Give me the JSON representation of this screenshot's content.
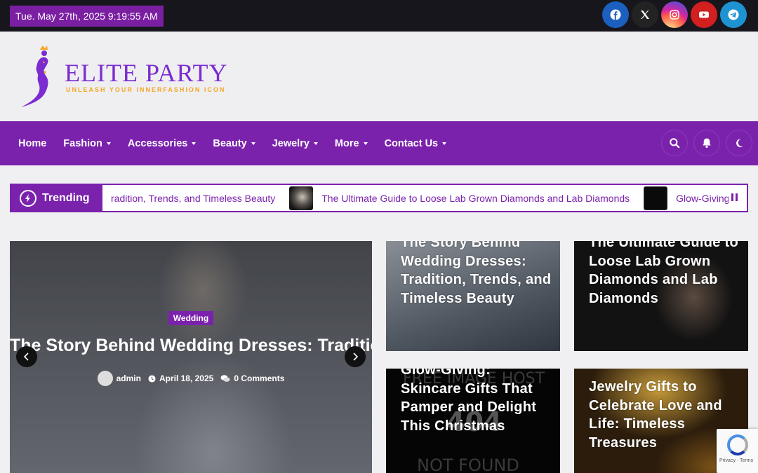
{
  "topbar": {
    "date": "Tue. May 27th, 2025 9:19:55 AM",
    "socials": [
      {
        "name": "facebook-icon",
        "color": "#1b5fbf"
      },
      {
        "name": "x-icon",
        "color": "#232323"
      },
      {
        "name": "instagram-icon",
        "color": "#c13584"
      },
      {
        "name": "youtube-icon",
        "color": "#d21f1f"
      },
      {
        "name": "telegram-icon",
        "color": "#1d93d2"
      }
    ]
  },
  "logo": {
    "title": "ELITE PARTY",
    "tagline": "UNLEASH YOUR INNERFASHION ICON"
  },
  "nav": {
    "items": [
      {
        "label": "Home",
        "dropdown": false
      },
      {
        "label": "Fashion",
        "dropdown": true
      },
      {
        "label": "Accessories",
        "dropdown": true
      },
      {
        "label": "Beauty",
        "dropdown": true
      },
      {
        "label": "Jewelry",
        "dropdown": true
      },
      {
        "label": "More",
        "dropdown": true
      },
      {
        "label": "Contact Us",
        "dropdown": true
      }
    ],
    "actions": [
      "search-icon",
      "bell-icon",
      "moon-icon"
    ]
  },
  "trending": {
    "label": "Trending",
    "items": [
      "radition, Trends, and Timeless Beauty",
      "The Ultimate Guide to Loose Lab Grown Diamonds and Lab Diamonds",
      "Glow-Giving"
    ]
  },
  "hero": {
    "category": "Wedding",
    "title": "The Story Behind Wedding Dresses: Tradition, Trends, and Timeless Beauty",
    "author": "admin",
    "date": "April 18, 2025",
    "comments": "0 Comments"
  },
  "cards": [
    {
      "title": "The Story Behind Wedding Dresses: Tradition, Trends, and Timeless Beauty"
    },
    {
      "title": "The Ultimate Guide to Loose Lab Grown Diamonds and Lab Diamonds"
    },
    {
      "title": "Glow-Giving: Skincare Gifts That Pamper and Delight This Christmas"
    },
    {
      "title": "Jewelry Gifts to Celebrate Love and Life: Timeless Treasures"
    }
  ],
  "not_found_image": {
    "line1": "FREE IMAGE HOST",
    "line2": "404",
    "line3": "NOT FOUND"
  },
  "recaptcha": {
    "text": "Privacy - Terms"
  }
}
